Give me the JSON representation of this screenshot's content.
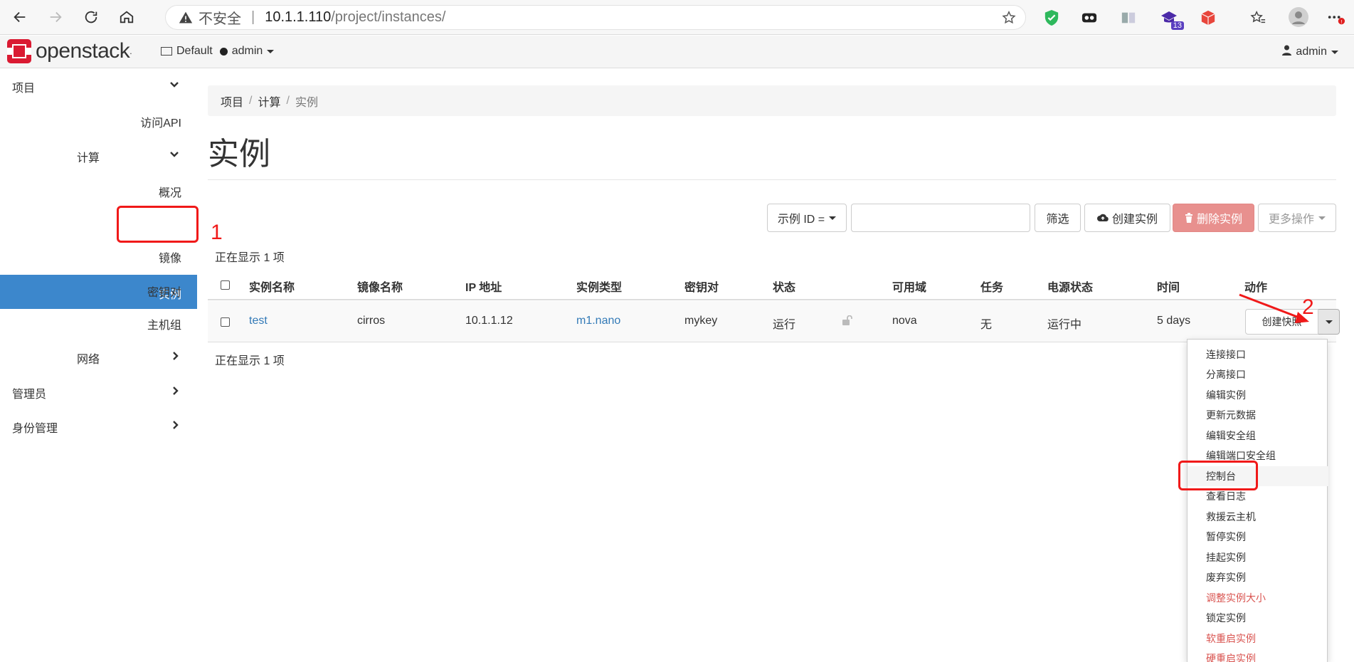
{
  "browser": {
    "address_warning": "不安全",
    "address_separator": "|",
    "address_host": "10.1.1.110",
    "address_path": "/project/instances/",
    "extension_badge": "13"
  },
  "header": {
    "logo_text": "openstack",
    "logo_reg": ".",
    "domain": "Default",
    "project": "admin",
    "user": "admin"
  },
  "sidebar": {
    "project": "项目",
    "access_api": "访问API",
    "compute": "计算",
    "overview": "概况",
    "instances": "实例",
    "images": "镜像",
    "key_pairs": "密钥对",
    "host_groups": "主机组",
    "network": "网络",
    "admin": "管理员",
    "identity": "身份管理"
  },
  "breadcrumb": {
    "item1": "项目",
    "item2": "计算",
    "item3": "实例",
    "sep": "/"
  },
  "page_title": "实例",
  "toolbar": {
    "filter_select": "示例 ID =",
    "filter_button": "筛选",
    "create_button": "创建实例",
    "delete_button": "删除实例",
    "more_button": "更多操作"
  },
  "count_text": "正在显示 1 项",
  "table": {
    "headers": [
      "实例名称",
      "镜像名称",
      "IP 地址",
      "实例类型",
      "密钥对",
      "状态",
      "可用域",
      "任务",
      "电源状态",
      "时间",
      "动作"
    ],
    "row": {
      "name": "test",
      "image": "cirros",
      "ip": "10.1.1.12",
      "flavor": "m1.nano",
      "key_pair": "mykey",
      "status": "运行",
      "zone": "nova",
      "task": "无",
      "power": "运行中",
      "age": "5 days",
      "action": "创建快照"
    }
  },
  "dropdown": {
    "items": [
      "连接接口",
      "分离接口",
      "编辑实例",
      "更新元数据",
      "编辑安全组",
      "编辑端口安全组",
      "控制台",
      "查看日志",
      "救援云主机",
      "暂停实例",
      "挂起实例",
      "废弃实例",
      "调整实例大小",
      "锁定实例",
      "软重启实例",
      "硬重启实例"
    ]
  },
  "annotations": {
    "label1": "1",
    "label2": "2"
  },
  "colors": {
    "sidebar_active": "#3c87cc",
    "link": "#337ab7",
    "danger": "#d9534f",
    "annotation": "#f01919",
    "logo_red": "#da1a32"
  }
}
